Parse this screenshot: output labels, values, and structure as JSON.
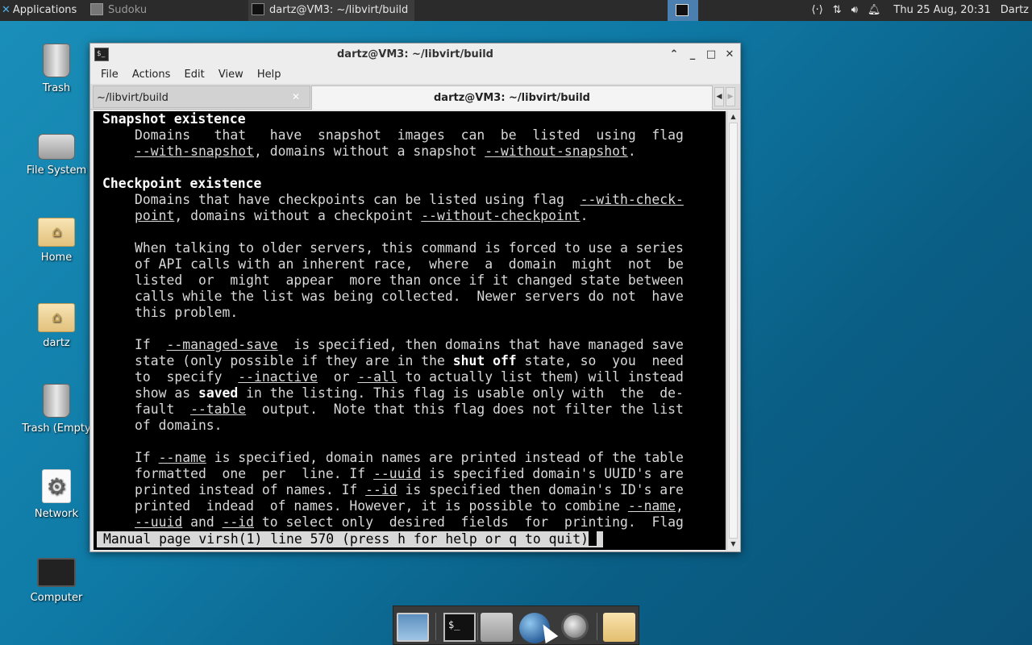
{
  "top_panel": {
    "applications_label": "Applications",
    "tasks": [
      {
        "label": "Sudoku"
      },
      {
        "label": "dartz@VM3: ~/libvirt/build"
      }
    ],
    "clock": "Thu 25 Aug, 20:31",
    "user": "Dartz"
  },
  "desktop": {
    "icons": [
      {
        "label": "Trash"
      },
      {
        "label": "File System"
      },
      {
        "label": "Home"
      },
      {
        "label": "dartz"
      },
      {
        "label": "Trash (Empty"
      },
      {
        "label": "Network"
      },
      {
        "label": "Computer"
      }
    ]
  },
  "window": {
    "title": "dartz@VM3: ~/libvirt/build",
    "menu": [
      "File",
      "Actions",
      "Edit",
      "View",
      "Help"
    ],
    "tabs": [
      {
        "label": "~/libvirt/build"
      },
      {
        "label": "dartz@VM3: ~/libvirt/build"
      }
    ],
    "terminal": {
      "h1": "Snapshot existence",
      "p1a_pre": "Domains   that   have  snapshot  images  can  be  listed  using  flag",
      "p1b_u1": "--with-snapshot",
      "p1b_mid": ", domains without a snapshot ",
      "p1b_u2": "--without-snapshot",
      "p1b_end": ".",
      "h2": "Checkpoint existence",
      "p2a_pre": "Domains that have checkpoints can be listed using flag  ",
      "p2a_u": "--with-check-",
      "p2b_u1": "point",
      "p2b_mid": ", domains without a checkpoint ",
      "p2b_u2": "--without-checkpoint",
      "p2b_end": ".",
      "p3": [
        "When talking to older servers, this command is forced to use a series",
        "of API calls with an inherent race,  where  a  domain  might  not  be",
        "listed  or  might  appear  more than once if it changed state between",
        "calls while the list was being collected.  Newer servers do not  have",
        "this problem."
      ],
      "p4a_1": "If  ",
      "p4a_u": "--managed-save",
      "p4a_2": "  is specified, then domains that have managed save",
      "p4b_1": "state (only possible if they are in the ",
      "p4b_b": "shut off",
      "p4b_2": " state, so  you  need",
      "p4c_1": "to  specify  ",
      "p4c_u1": "--inactive",
      "p4c_2": "  or ",
      "p4c_u2": "--all",
      "p4c_3": " to actually list them) will instead",
      "p4d_1": "show as ",
      "p4d_b": "saved",
      "p4d_2": " in the listing. This flag is usable only with  the  de-",
      "p4e_1": "fault  ",
      "p4e_u": "--table",
      "p4e_2": "  output.  Note that this flag does not filter the list",
      "p4f": "of domains.",
      "p5a_1": "If ",
      "p5a_u": "--name",
      "p5a_2": " is specified, domain names are printed instead of the table",
      "p5b_1": "formatted  one  per  line. If ",
      "p5b_u": "--uuid",
      "p5b_2": " is specified domain's UUID's are",
      "p5c_1": "printed instead of names. If ",
      "p5c_u": "--id",
      "p5c_2": " is specified then domain's ID's are",
      "p5d_1": "printed  indead  of names. However, it is possible to combine ",
      "p5d_u": "--name",
      "p5d_2": ",",
      "p5e_u1": "--uuid",
      "p5e_1": " and ",
      "p5e_u2": "--id",
      "p5e_2": " to select only  desired  fields  for  printing.  Flag",
      "status": "Manual page virsh(1) line 570 (press h for help or q to quit)"
    }
  }
}
